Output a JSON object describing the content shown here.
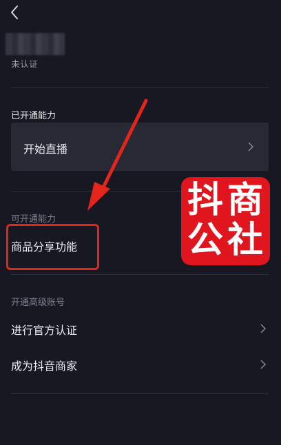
{
  "header": {
    "back_icon": "chevron-left-icon",
    "verification_status": "未认证"
  },
  "enabled": {
    "title": "已开通能力",
    "items": [
      {
        "label": "开始直播",
        "icon": "chevron-right-icon"
      }
    ]
  },
  "available": {
    "title": "可开通能力",
    "items": [
      {
        "label": "商品分享功能"
      }
    ]
  },
  "advanced": {
    "title": "开通高级账号",
    "items": [
      {
        "label": "进行官方认证",
        "icon": "chevron-right-icon"
      },
      {
        "label": "成为抖音商家",
        "icon": "chevron-right-icon"
      }
    ]
  },
  "watermark": {
    "text": "抖商公社",
    "color": "#e0151d"
  },
  "annotation_color": "#e3251c"
}
